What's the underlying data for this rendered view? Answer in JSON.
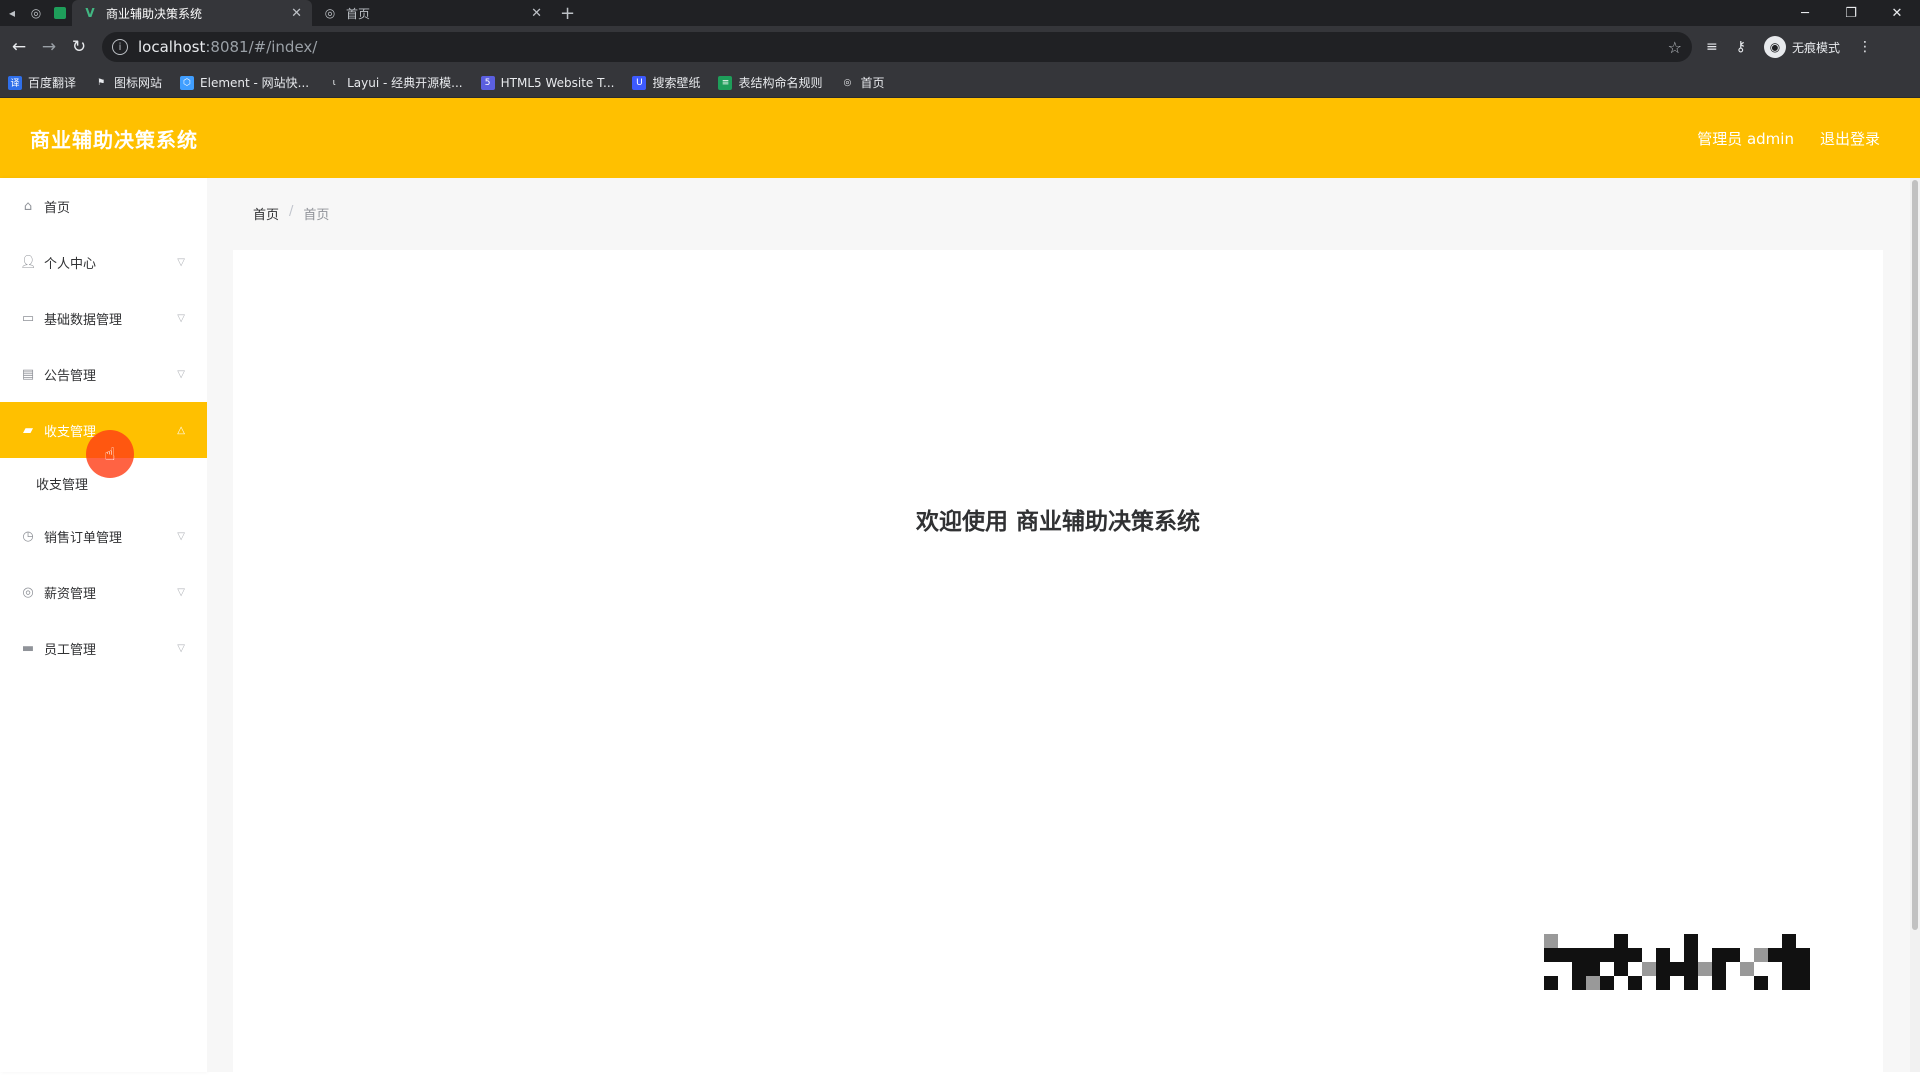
{
  "browser": {
    "tabs": [
      {
        "title": "商业辅助决策系统",
        "active": true,
        "favicon": "vue-icon"
      },
      {
        "title": "首页",
        "active": false,
        "favicon": "globe-icon"
      }
    ],
    "url_host": "localhost",
    "url_path": ":8081/#/index/",
    "profile_label": "无痕模式",
    "bookmarks": [
      {
        "label": "百度翻译",
        "icon": "translate-icon",
        "color": "#2f6fea"
      },
      {
        "label": "图标网站",
        "icon": "flag-icon",
        "color": "#444444"
      },
      {
        "label": "Element - 网站快...",
        "icon": "element-icon",
        "color": "#409eff"
      },
      {
        "label": "Layui - 经典开源模...",
        "icon": "layui-icon",
        "color": "#555555"
      },
      {
        "label": "HTML5 Website T...",
        "icon": "html5-icon",
        "color": "#5b5fe0"
      },
      {
        "label": "搜索壁纸",
        "icon": "wallpaper-icon",
        "color": "#3d5afe"
      },
      {
        "label": "表结构命名规则",
        "icon": "sheet-icon",
        "color": "#1e9e5a"
      },
      {
        "label": "首页",
        "icon": "globe-icon",
        "color": "#777777"
      }
    ]
  },
  "app": {
    "title": "商业辅助决策系统",
    "user_label": "管理员 admin",
    "logout_label": "退出登录",
    "accent_color": "#ffc000"
  },
  "sidebar": {
    "items": [
      {
        "label": "首页",
        "icon": "home-icon",
        "has_children": false
      },
      {
        "label": "个人中心",
        "icon": "user-icon",
        "has_children": true
      },
      {
        "label": "基础数据管理",
        "icon": "message-icon",
        "has_children": true
      },
      {
        "label": "公告管理",
        "icon": "document-icon",
        "has_children": true
      },
      {
        "label": "收支管理",
        "icon": "folder-icon",
        "has_children": true,
        "active": true,
        "children": [
          "收支管理"
        ]
      },
      {
        "label": "销售订单管理",
        "icon": "clock-icon",
        "has_children": true
      },
      {
        "label": "薪资管理",
        "icon": "settings-icon",
        "has_children": true
      },
      {
        "label": "员工管理",
        "icon": "briefcase-icon",
        "has_children": true
      }
    ]
  },
  "breadcrumb": [
    "首页",
    "首页"
  ],
  "main": {
    "welcome": "欢迎使用 商业辅助决策系统"
  }
}
